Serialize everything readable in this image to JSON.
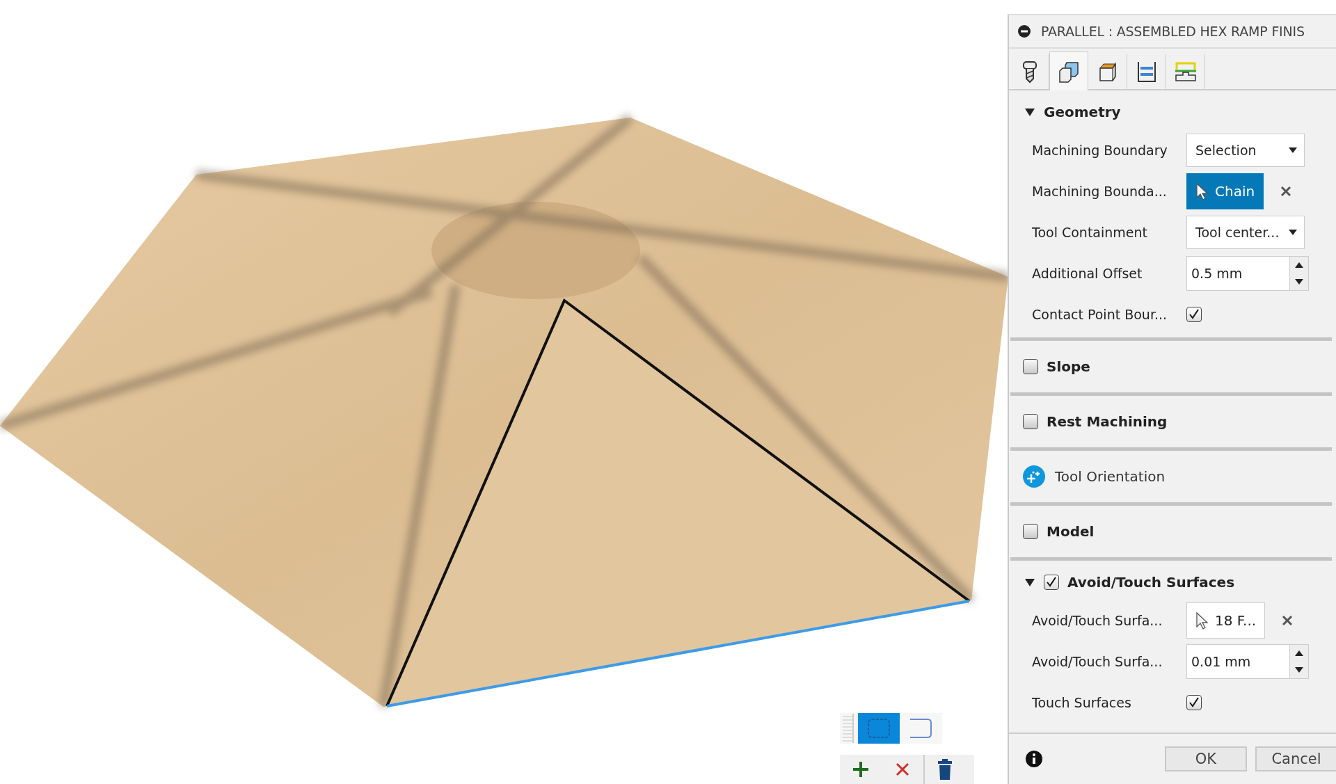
{
  "viewport": {
    "selection_modes": [
      {
        "kind": "window",
        "selected": true
      },
      {
        "kind": "free",
        "selected": false
      }
    ]
  },
  "panel": {
    "title": "PARALLEL : ASSEMBLED HEX RAMP FINIS",
    "tabs": [
      {
        "kind": "tool",
        "selected": false
      },
      {
        "kind": "geometry",
        "selected": true
      },
      {
        "kind": "heights",
        "selected": false
      },
      {
        "kind": "passes",
        "selected": false
      },
      {
        "kind": "linking",
        "selected": false
      }
    ],
    "sections": [
      {
        "kind": "group",
        "title": "Geometry",
        "expanded": true,
        "fields": [
          {
            "kind": "dropdown",
            "label": "Machining Boundary",
            "value": "Selection"
          },
          {
            "kind": "selection",
            "label": "Machining Bounda...",
            "value": "Chain",
            "active": true
          },
          {
            "kind": "dropdown",
            "label": "Tool Containment",
            "value": "Tool center..."
          },
          {
            "kind": "spinner",
            "label": "Additional Offset",
            "value": "0.5 mm"
          },
          {
            "kind": "checkbox",
            "label": "Contact Point Bour...",
            "checked": true
          }
        ]
      },
      {
        "kind": "checkbox",
        "title": "Slope",
        "checked": false
      },
      {
        "kind": "checkbox",
        "title": "Rest Machining",
        "checked": false
      },
      {
        "kind": "link",
        "title": "Tool Orientation"
      },
      {
        "kind": "checkbox",
        "title": "Model",
        "checked": false
      },
      {
        "kind": "group",
        "title": "Avoid/Touch Surfaces",
        "expanded": true,
        "checked": true,
        "fields": [
          {
            "kind": "selection",
            "label": "Avoid/Touch Surfa...",
            "value": "18 F...",
            "active": false
          },
          {
            "kind": "spinner",
            "label": "Avoid/Touch Surfa...",
            "value": "0.01 mm"
          },
          {
            "kind": "checkbox",
            "label": "Touch Surfaces",
            "checked": true
          }
        ]
      }
    ],
    "buttons": [
      "OK",
      "Cancel"
    ]
  }
}
